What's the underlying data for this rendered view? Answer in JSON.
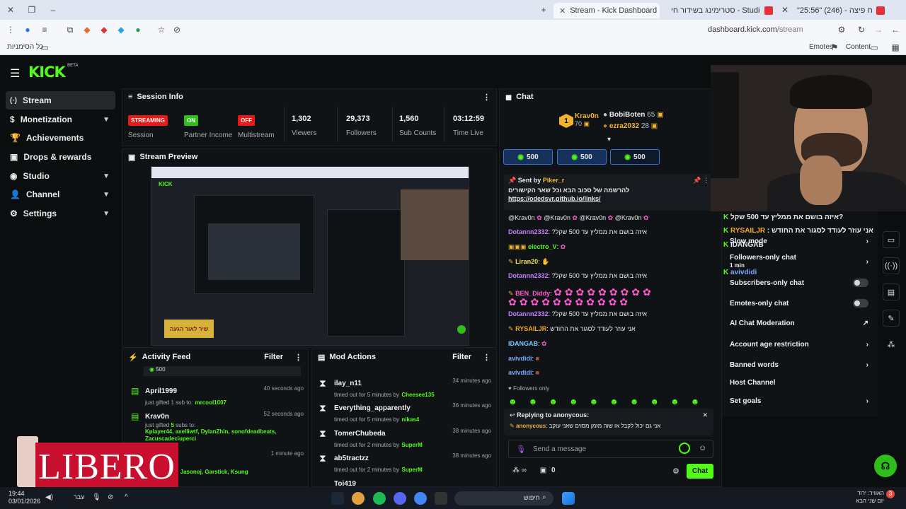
{
  "browser": {
    "tabs": [
      {
        "title": "\"25:56\" (246) - שליח פיצה",
        "active": false,
        "color": "#e7313a"
      },
      {
        "title": "סטרימינג בשידור חי - Studio",
        "active": false,
        "color": "#e7313a"
      },
      {
        "title": "Stream - Kick Dashboard",
        "active": true,
        "color": "#53fc18"
      }
    ],
    "url_host": "dashboard.kick.com",
    "url_path": "/stream",
    "bookmarks_all": "כל הסימניות",
    "bookmark_emotes": "Emotes",
    "bookmark_content": "Content"
  },
  "app": {
    "logo": "KICK",
    "logo_beta": "BETA",
    "sidebar": [
      {
        "label": "Stream",
        "icon": "stream-icon",
        "active": true,
        "chevron": false
      },
      {
        "label": "Monetization",
        "icon": "dollar-icon",
        "active": false,
        "chevron": true
      },
      {
        "label": "Achievements",
        "icon": "trophy-icon",
        "active": false,
        "chevron": false
      },
      {
        "label": "Drops & rewards",
        "icon": "gift-icon",
        "active": false,
        "chevron": false
      },
      {
        "label": "Studio",
        "icon": "studio-icon",
        "active": false,
        "chevron": true
      },
      {
        "label": "Channel",
        "icon": "user-icon",
        "active": false,
        "chevron": true
      },
      {
        "label": "Settings",
        "icon": "gear-icon",
        "active": false,
        "chevron": true
      }
    ]
  },
  "session": {
    "title": "Session Info",
    "stats": [
      {
        "badge": "STREAMING",
        "badge_color": "#e91916",
        "label": "Session"
      },
      {
        "badge": "ON",
        "badge_color": "#2fbf1b",
        "label": "Partner Income"
      },
      {
        "badge": "OFF",
        "badge_color": "#e91916",
        "label": "Multistream"
      },
      {
        "value": "1,302",
        "label": "Viewers"
      },
      {
        "value": "29,373",
        "label": "Followers"
      },
      {
        "value": "1,560",
        "label": "Sub Counts"
      },
      {
        "value": "03:12:59",
        "label": "Time Live"
      }
    ]
  },
  "preview": {
    "title": "Stream Preview",
    "overlay_text": "שיר לאור הגעה"
  },
  "activity": {
    "title": "Activity Feed",
    "filter": "Filter",
    "top_amount": "500",
    "items": [
      {
        "name": "April1999",
        "time": "40 seconds ago",
        "action": "just gifted 1 sub to:",
        "targets": "mrcool1007"
      },
      {
        "name": "Krav0n",
        "time": "52 seconds ago",
        "action_pre": "just gifted ",
        "count": "5",
        "action_post": " subs to:",
        "targets": "Kplayer44, axelliwtf, DylanZhin, sonofdeadbeats, Zacuscadeciuperci"
      },
      {
        "name": "",
        "time": "1 minute ago",
        "action": "",
        "targets": "laTeDrOnEs, Jasonoj, Garstick, Ksung"
      }
    ]
  },
  "mod": {
    "title": "Mod Actions",
    "filter": "Filter",
    "items": [
      {
        "name": "ilay_n11",
        "time": "34 minutes ago",
        "action": "timed out for 5 minutes by",
        "by": "Cheesee135"
      },
      {
        "name": "Everything_apparently",
        "time": "36 minutes ago",
        "action": "timed out for 5 minutes by",
        "by": "nikas4"
      },
      {
        "name": "TomerChubeda",
        "time": "38 minutes ago",
        "action": "timed out for 2 minutes by",
        "by": "SuperM"
      },
      {
        "name": "ab5tractzz",
        "time": "38 minutes ago",
        "action": "timed out for 2 minutes by",
        "by": "SuperM"
      },
      {
        "name": "Toi419",
        "time": "",
        "action": "",
        "by": ""
      }
    ]
  },
  "chat": {
    "title": "Chat",
    "leaderboard": [
      {
        "rank": "1",
        "name": "Krav0n",
        "count": "70"
      },
      {
        "name": "BobiBoten",
        "count": "65"
      },
      {
        "name": "ezra2032",
        "count": "28"
      }
    ],
    "goals": [
      "500",
      "500",
      "500"
    ],
    "pinned": {
      "sent_by_label": "Sent by",
      "sender": "Piker_r",
      "text": "להרשמה של סכוב הבא וכל שאר הקישורים",
      "link": "https://odedsvr.github.io/links/"
    },
    "mentions": [
      "@Krav0n",
      "@Krav0n",
      "@Krav0n",
      "@Krav0n"
    ],
    "messages": [
      {
        "user": "Dotannn2332",
        "color": "#c77dff",
        "text": "?איזה בושם את ממליץ עד 500 שקל"
      },
      {
        "user": "electro_V",
        "color": "#53fc18",
        "text": ""
      },
      {
        "user": "Liran20",
        "color": "#f5e14a",
        "text": ""
      },
      {
        "user": "Dotannn2332",
        "color": "#c77dff",
        "text": "?איזה בושם את ממליץ עד 500 שקל"
      },
      {
        "user": "BEN_Diddy",
        "color": "#ff5ad0",
        "text": ""
      },
      {
        "user": "Dotannn2332",
        "color": "#c77dff",
        "text": "?איזה בושם את ממליץ עד 500 שקל"
      },
      {
        "user": "RYSAILJR",
        "color": "#f5a623",
        "text": "אני עוזר לעודד לסגור את החודש"
      },
      {
        "user": "IDANGAB",
        "color": "#7ec8ff",
        "text": ""
      },
      {
        "user": "avivdidi",
        "color": "#7aa7ff",
        "text": ""
      },
      {
        "user": "avivdidi",
        "color": "#7aa7ff",
        "text": ""
      }
    ],
    "followers_only": "Followers only",
    "reply_label": "Replying to anonycous:",
    "reply_user": "anonycous",
    "reply_text": "אני גם יכול לקבל או שזה מזמן מסוים שאני עוקב",
    "input_placeholder": "Send a message",
    "points": "0",
    "send_button": "Chat"
  },
  "chat_settings": {
    "overlay_lines": [
      {
        "user": "",
        "text": "איזה בושם את ממליץ עד 500 שקל?"
      },
      {
        "user": "RYSAILJR",
        "text": "אני עוזר לעודד לסגור את החודש"
      },
      {
        "user": "IDANGAB",
        "text": ""
      },
      {
        "user": "avivdidi",
        "text": ""
      }
    ],
    "items": [
      {
        "label": "Slow mode",
        "control": "chevron"
      },
      {
        "label": "Followers-only chat",
        "control": "chevron",
        "sub": "1 min"
      },
      {
        "label": "Subscribers-only chat",
        "control": "toggle"
      },
      {
        "label": "Emotes-only chat",
        "control": "toggle"
      },
      {
        "label": "AI Chat Moderation",
        "control": "external"
      },
      {
        "label": "Account age restriction",
        "control": "chevron"
      },
      {
        "label": "Banned words",
        "control": "chevron"
      },
      {
        "label": "Host Channel",
        "control": "none"
      },
      {
        "label": "Set goals",
        "control": "chevron"
      }
    ]
  },
  "ad": {
    "brand": "LIBERO"
  },
  "taskbar": {
    "time": "19:44",
    "date": "03/01/2026",
    "lang": "עבר",
    "search": "חיפוש",
    "weather": "האוויר: ירוד",
    "weather_sub": "יום שני הבא",
    "notif": "3"
  }
}
